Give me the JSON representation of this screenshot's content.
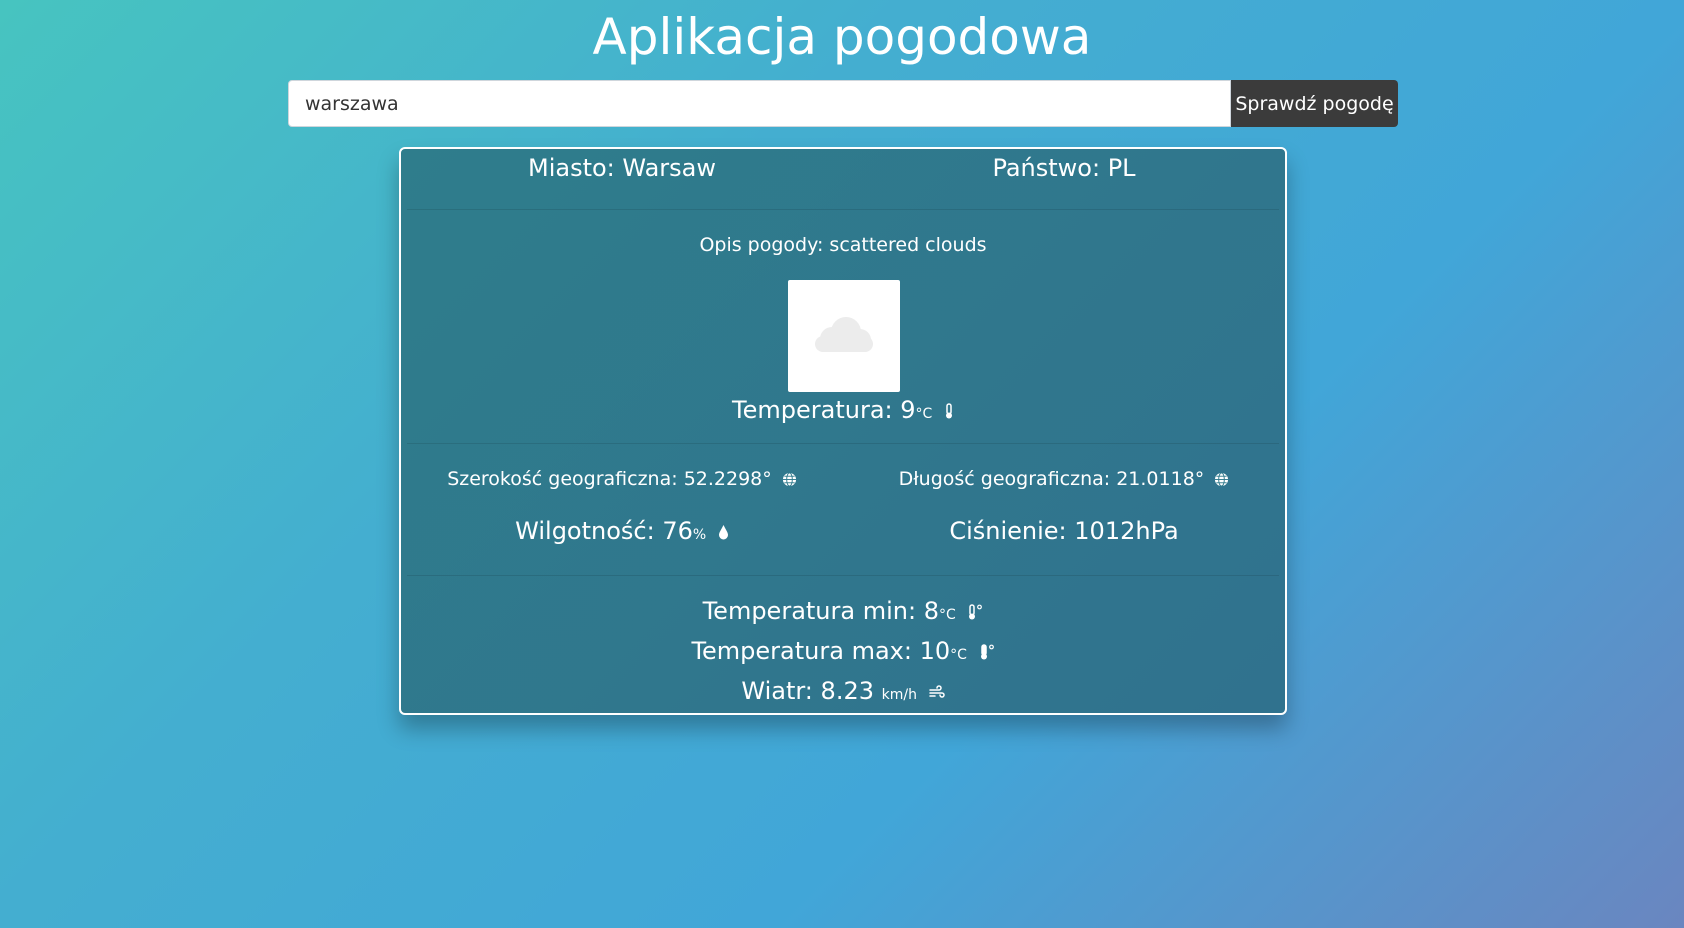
{
  "app": {
    "title": "Aplikacja pogodowa"
  },
  "search": {
    "value": "warszawa",
    "button_label": "Sprawdź pogodę"
  },
  "location": {
    "city_label": "Miasto:",
    "city": "Warsaw",
    "country_label": "Państwo:",
    "country": "PL"
  },
  "description": {
    "label": "Opis pogody:",
    "value": "scattered clouds"
  },
  "weather_icon": "cloud-icon",
  "temperature": {
    "label": "Temperatura:",
    "value": "9",
    "unit": "°C"
  },
  "coordinates": {
    "lat_label": "Szerokość geograficzna:",
    "lat": "52.2298°",
    "lon_label": "Długość geograficzna:",
    "lon": "21.0118°"
  },
  "humidity": {
    "label": "Wilgotność:",
    "value": "76",
    "unit": "%"
  },
  "pressure": {
    "label": "Ciśnienie:",
    "value": "1012hPa"
  },
  "temp_min": {
    "label": "Temperatura min:",
    "value": "8",
    "unit": "°C"
  },
  "temp_max": {
    "label": "Temperatura max:",
    "value": "10",
    "unit": "°C"
  },
  "wind": {
    "label": "Wiatr:",
    "value": "8.23",
    "unit": "km/h"
  },
  "colors": {
    "button_bg": "#3b3b3b",
    "card_bg": "#2f7a8d",
    "text": "#ffffff"
  }
}
